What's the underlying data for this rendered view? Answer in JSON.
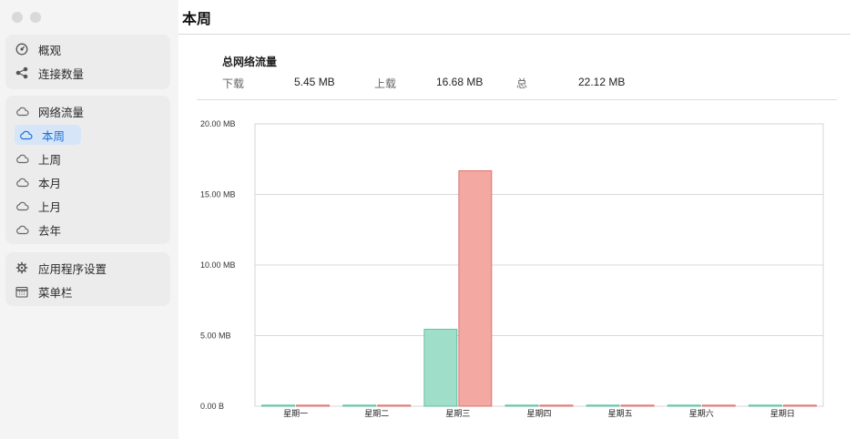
{
  "sidebar": {
    "groups": [
      {
        "items": [
          {
            "label": "概观",
            "icon": "dashboard-gauge-icon"
          },
          {
            "label": "连接数量",
            "icon": "share-nodes-icon"
          }
        ]
      },
      {
        "items": [
          {
            "label": "网络流量",
            "icon": "cloud-icon"
          },
          {
            "label": "本周",
            "icon": "cloud-icon",
            "active": true
          },
          {
            "label": "上周",
            "icon": "cloud-icon"
          },
          {
            "label": "本月",
            "icon": "cloud-icon"
          },
          {
            "label": "上月",
            "icon": "cloud-icon"
          },
          {
            "label": "去年",
            "icon": "cloud-icon"
          }
        ]
      },
      {
        "items": [
          {
            "label": "应用程序设置",
            "icon": "gear-icon"
          },
          {
            "label": "菜单栏",
            "icon": "calendar-grid-icon"
          }
        ]
      }
    ]
  },
  "main": {
    "title": "本周",
    "summary": {
      "heading": "总网络流量",
      "download_label": "下载",
      "download_value": "5.45 MB",
      "upload_label": "上载",
      "upload_value": "16.68 MB",
      "total_label": "总",
      "total_value": "22.12 MB"
    }
  },
  "colors": {
    "accent": "#1d6fd6",
    "download": "#9fdfc9",
    "download_stroke": "#45b896",
    "upload": "#f4a8a2",
    "upload_stroke": "#d9625a"
  },
  "chart_data": {
    "type": "bar",
    "categories": [
      "星期一",
      "星期二",
      "星期三",
      "星期四",
      "星期五",
      "星期六",
      "星期日"
    ],
    "series": [
      {
        "values": [
          0,
          0,
          5.45,
          0,
          0,
          0,
          0
        ]
      },
      {
        "values": [
          0,
          0,
          16.68,
          0,
          0,
          0,
          0
        ]
      }
    ],
    "ylim": [
      0,
      20
    ],
    "yticks": [
      "0.00 B",
      "5.00 MB",
      "10.00 MB",
      "15.00 MB",
      "20.00 MB"
    ],
    "grid": true
  }
}
